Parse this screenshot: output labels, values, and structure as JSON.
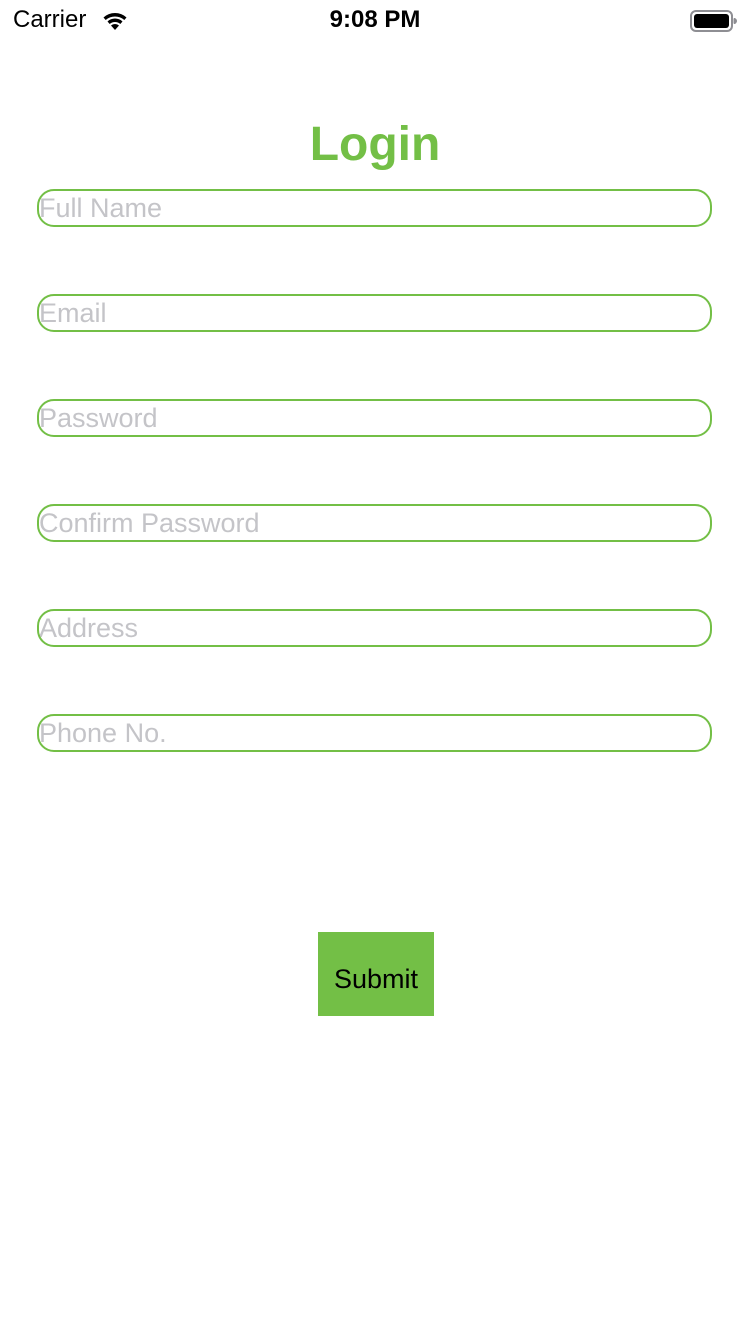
{
  "status_bar": {
    "carrier": "Carrier",
    "time": "9:08 PM",
    "icons": [
      "wifi-icon",
      "battery-icon"
    ]
  },
  "form": {
    "title": "Login",
    "fields": {
      "full_name": {
        "placeholder": "Full Name",
        "value": ""
      },
      "email": {
        "placeholder": "Email",
        "value": ""
      },
      "password": {
        "placeholder": "Password",
        "value": ""
      },
      "confirm_password": {
        "placeholder": "Confirm Password",
        "value": ""
      },
      "address": {
        "placeholder": "Address",
        "value": ""
      },
      "phone": {
        "placeholder": "Phone No.",
        "value": ""
      }
    },
    "submit_label": "Submit"
  },
  "colors": {
    "accent": "#73bf46",
    "placeholder": "#c4c4c8",
    "background": "#ffffff"
  }
}
